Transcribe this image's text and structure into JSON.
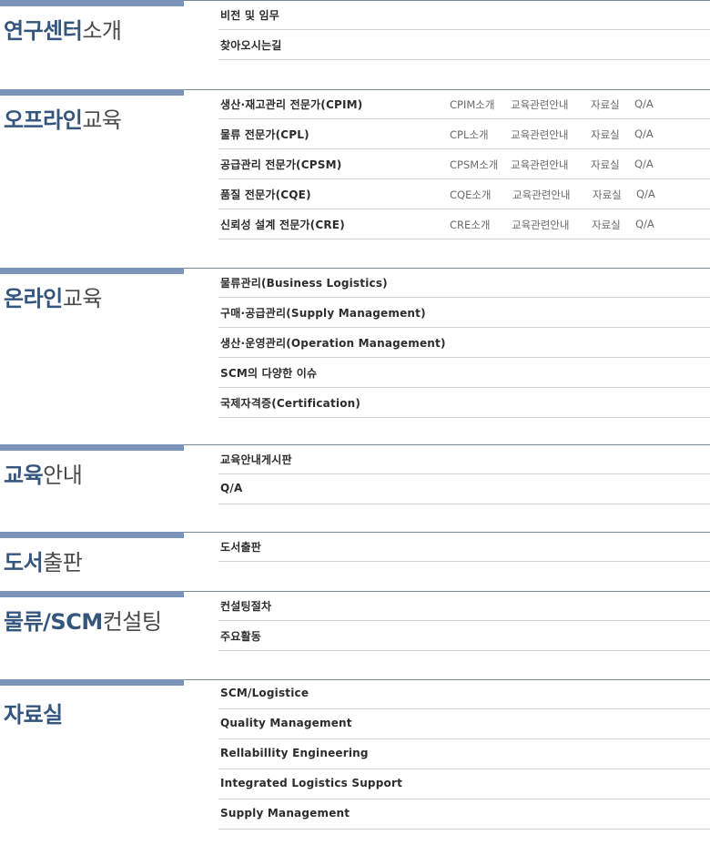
{
  "sections": [
    {
      "title_bold": "연구센터",
      "title_normal": "소개",
      "items": [
        {
          "label": "비전 및 임무"
        },
        {
          "label": "찾아오시는길"
        }
      ]
    },
    {
      "title_bold": "오프라인",
      "title_normal": "교육",
      "items": [
        {
          "label": "생산·재고관리 전문가(CPIM)",
          "links": [
            "CPIM소개",
            "교육관련안내",
            "자료실",
            "Q/A"
          ]
        },
        {
          "label": "물류 전문가(CPL)",
          "links": [
            "CPL소개",
            "교육관련안내",
            "자료실",
            "Q/A"
          ]
        },
        {
          "label": "공급관리 전문가(CPSM)",
          "links": [
            "CPSM소개",
            "교육관련안내",
            "자료실",
            "Q/A"
          ]
        },
        {
          "label": "품질 전문가(CQE)",
          "links": [
            "CQE소개",
            "교육관련안내",
            "자료실",
            "Q/A"
          ]
        },
        {
          "label": "신뢰성 설계 전문가(CRE)",
          "links": [
            "CRE소개",
            "교육관련안내",
            "자료실",
            "Q/A"
          ]
        }
      ]
    },
    {
      "title_bold": "온라인",
      "title_normal": "교육",
      "items": [
        {
          "label": "물류관리(Business Logistics)"
        },
        {
          "label": "구매·공급관리(Supply Management)"
        },
        {
          "label": "생산·운영관리(Operation Management)"
        },
        {
          "label": "SCM의 다양한 이슈"
        },
        {
          "label": "국제자격증(Certification)"
        }
      ]
    },
    {
      "title_bold": "교육",
      "title_normal": "안내",
      "items": [
        {
          "label": "교육안내게시판"
        },
        {
          "label": "Q/A"
        }
      ]
    },
    {
      "title_bold": "도서",
      "title_normal": "출판",
      "items": [
        {
          "label": "도서출판"
        }
      ]
    },
    {
      "title_bold": "물류/SCM",
      "title_normal": "컨설팅",
      "items": [
        {
          "label": "컨설팅절차"
        },
        {
          "label": "주요활동"
        }
      ]
    },
    {
      "title_bold": "자료실",
      "title_normal": "",
      "items": [
        {
          "label": "SCM/Logistice"
        },
        {
          "label": "Quality Management"
        },
        {
          "label": "Rellabillity Engineering"
        },
        {
          "label": "Integrated Logistics Support"
        },
        {
          "label": "Supply Management"
        }
      ]
    }
  ]
}
